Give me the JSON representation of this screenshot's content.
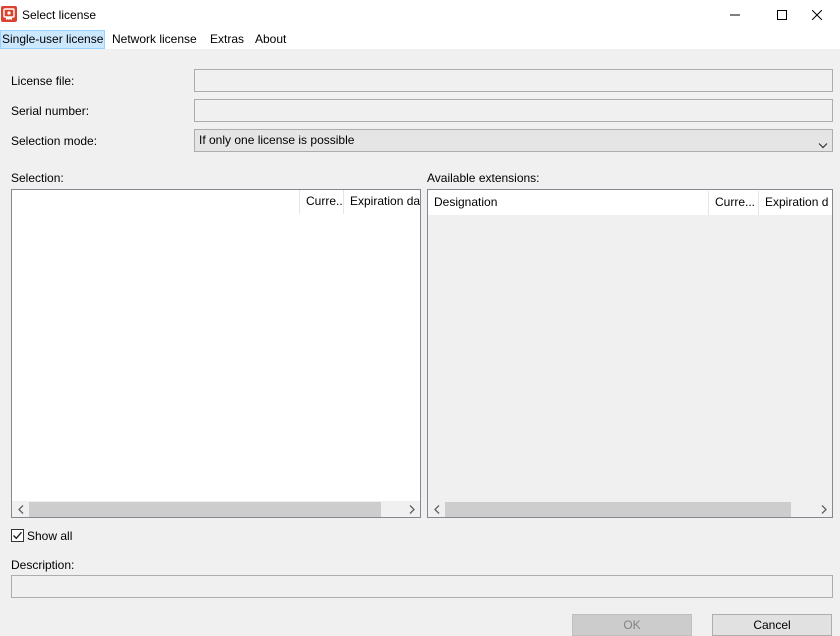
{
  "window": {
    "title": "Select license",
    "app_icon": "license-app-icon",
    "controls": [
      "minimize-icon",
      "maximize-icon",
      "close-icon"
    ]
  },
  "menu": {
    "items": [
      "Single-user license",
      "Network license",
      "Extras",
      "About"
    ],
    "active_item": "Single-user license"
  },
  "form": {
    "license_file_label": "License file:",
    "license_file_value": "",
    "serial_number_label": "Serial number:",
    "serial_number_value": "",
    "selection_mode_label": "Selection mode:",
    "selection_mode_value": "If only one license is possible"
  },
  "selection": {
    "label": "Selection:",
    "columns": [
      "",
      "Curre...",
      "Expiration da"
    ]
  },
  "extensions": {
    "label": "Available extensions:",
    "columns": [
      "Designation",
      "Curre...",
      "Expiration d"
    ]
  },
  "show_all": {
    "label": "Show all",
    "checked": true
  },
  "description": {
    "label": "Description:",
    "value": ""
  },
  "buttons": {
    "ok_label": "OK",
    "cancel_label": "Cancel"
  },
  "colors": {
    "app_icon": "#d9432f",
    "menu_highlight": "#cce8ff",
    "dialog_background": "#f0f0f0"
  }
}
